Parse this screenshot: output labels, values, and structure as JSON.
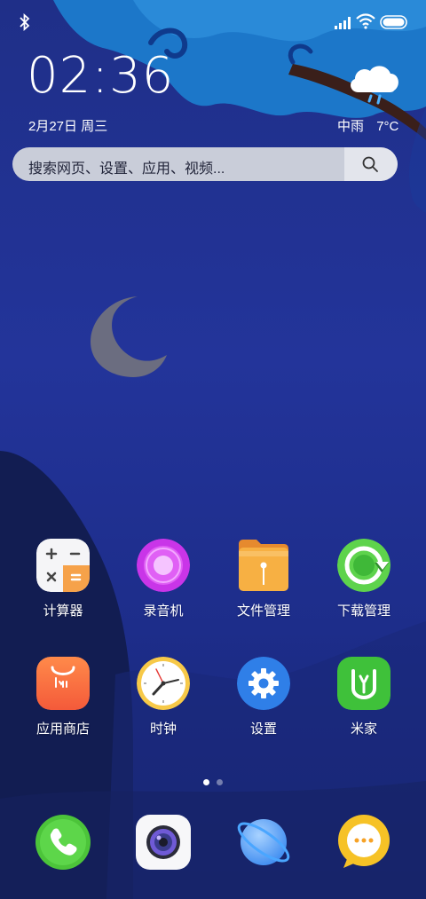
{
  "status_bar": {
    "bluetooth_icon": "bluetooth-icon",
    "signal_icon": "signal-icon",
    "wifi_icon": "wifi-icon",
    "battery_icon": "battery-icon"
  },
  "clock": {
    "time": "02:36",
    "date": "2月27日 周三"
  },
  "weather": {
    "condition": "中雨",
    "temperature": "7°C",
    "icon": "rain-cloud-icon"
  },
  "search": {
    "placeholder": "搜索网页、设置、应用、视频...",
    "icon": "search-icon"
  },
  "apps": [
    {
      "label": "计算器",
      "icon": "calculator-icon"
    },
    {
      "label": "录音机",
      "icon": "recorder-icon"
    },
    {
      "label": "文件管理",
      "icon": "file-manager-icon"
    },
    {
      "label": "下载管理",
      "icon": "download-manager-icon"
    },
    {
      "label": "应用商店",
      "icon": "app-store-icon"
    },
    {
      "label": "时钟",
      "icon": "clock-icon"
    },
    {
      "label": "设置",
      "icon": "settings-icon"
    },
    {
      "label": "米家",
      "icon": "mijia-icon"
    }
  ],
  "page_indicator": {
    "current": 1,
    "total": 2
  },
  "dock": [
    {
      "icon": "phone-icon"
    },
    {
      "icon": "camera-icon"
    },
    {
      "icon": "browser-icon"
    },
    {
      "icon": "messages-icon"
    }
  ],
  "colors": {
    "background": "#2233a0",
    "search_bar": "#c9cdd9",
    "accent_green": "#4cc43a"
  }
}
